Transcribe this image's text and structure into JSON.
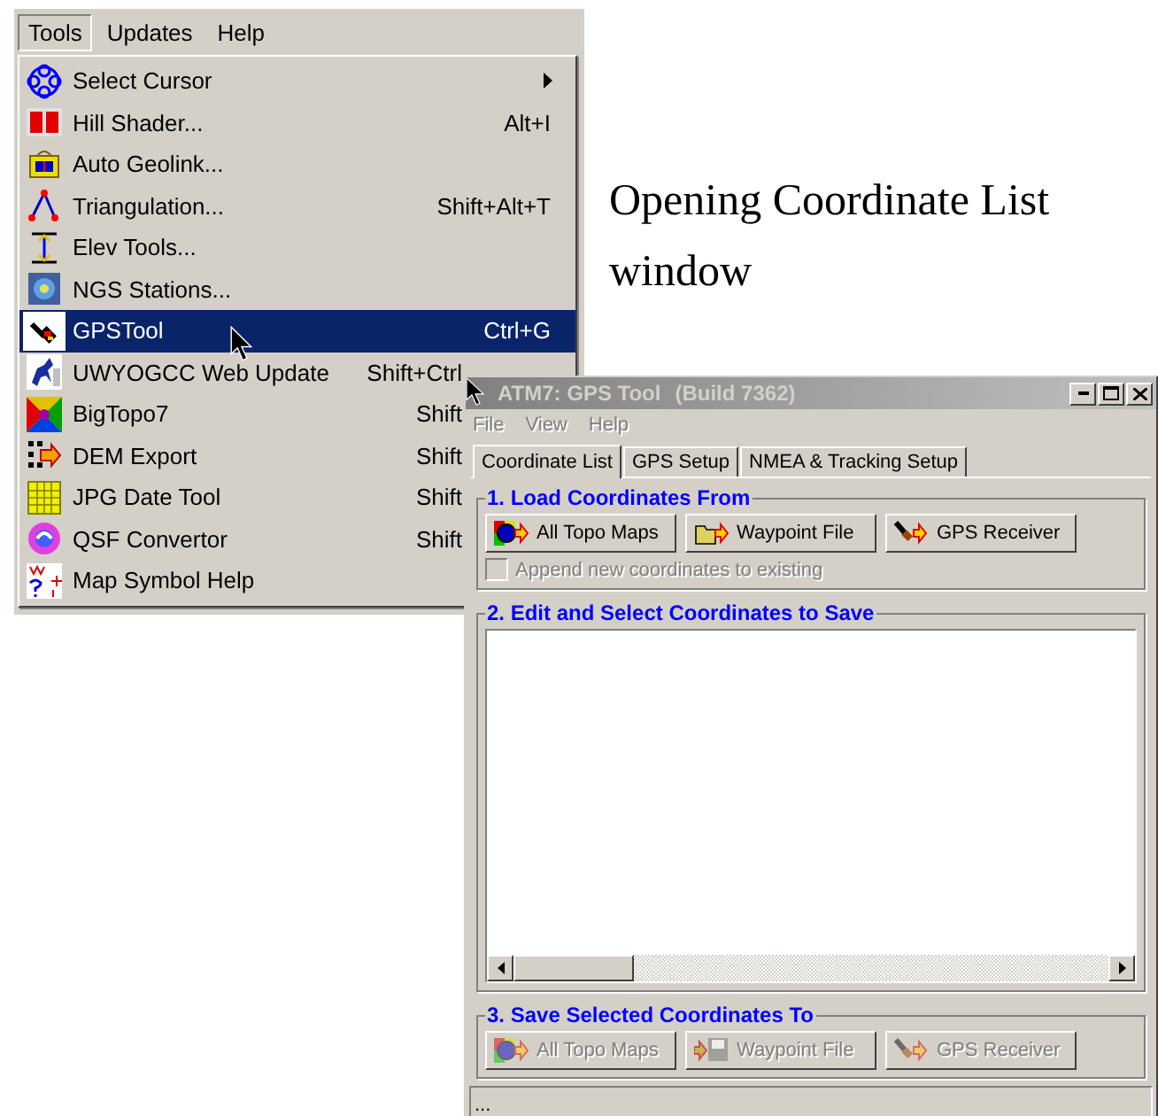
{
  "app_menubar": {
    "items": [
      {
        "label": "Tools",
        "selected": true
      },
      {
        "label": "Updates",
        "selected": false
      },
      {
        "label": "Help",
        "selected": false
      }
    ]
  },
  "tools_menu": {
    "items": [
      {
        "label": "Select Cursor",
        "submenu": true,
        "selected": false
      },
      {
        "label": "Hill Shader...",
        "shortcut": "Alt+I",
        "submenu": false,
        "selected": false
      },
      {
        "label": "Auto Geolink...",
        "submenu": false,
        "selected": false
      },
      {
        "label": "Triangulation...",
        "shortcut": "Shift+Alt+T",
        "submenu": false,
        "selected": false
      },
      {
        "label": "Elev Tools...",
        "submenu": false,
        "selected": false
      },
      {
        "label": "NGS Stations...",
        "submenu": false,
        "selected": false
      },
      {
        "label": "GPSTool",
        "shortcut": "Ctrl+G",
        "submenu": false,
        "selected": true
      },
      {
        "label": "UWYOGCC Web Update",
        "shortcut": "Shift+Ctrl",
        "submenu": false,
        "selected": false
      },
      {
        "label": "BigTopo7",
        "shortcut": "Shift",
        "submenu": false,
        "selected": false
      },
      {
        "label": "DEM Export",
        "shortcut": "Shift",
        "submenu": false,
        "selected": false
      },
      {
        "label": "JPG Date Tool",
        "shortcut": "Shift",
        "submenu": false,
        "selected": false
      },
      {
        "label": "QSF Convertor",
        "shortcut": "Shift",
        "submenu": false,
        "selected": false
      },
      {
        "label": "Map Symbol Help",
        "submenu": false,
        "selected": false
      }
    ]
  },
  "caption": "Opening Coordinate List window",
  "window": {
    "title": "ATM7: GPS Tool",
    "build": "(Build 7362)",
    "menu": [
      {
        "label": "File",
        "disabled": true
      },
      {
        "label": "View",
        "disabled": true
      },
      {
        "label": "Help",
        "disabled": true
      }
    ],
    "tabs": [
      {
        "label": "Coordinate List",
        "selected": true
      },
      {
        "label": "GPS Setup",
        "selected": false
      },
      {
        "label": "NMEA & Tracking Setup",
        "selected": false
      }
    ],
    "groups": [
      {
        "kind": "buttons",
        "title": "1. Load Coordinates From",
        "buttons": [
          {
            "label": "All Topo Maps",
            "disabled": false
          },
          {
            "label": "Waypoint File",
            "disabled": false
          },
          {
            "label": "GPS Receiver",
            "disabled": false
          }
        ],
        "checkbox": {
          "label": "Append new coordinates to existing",
          "checked": false,
          "disabled": true
        }
      },
      {
        "kind": "list",
        "title": "2. Edit and Select Coordinates to Save"
      },
      {
        "kind": "buttons",
        "title": "3. Save Selected Coordinates To",
        "buttons": [
          {
            "label": "All Topo Maps",
            "disabled": true
          },
          {
            "label": "Waypoint File",
            "disabled": true
          },
          {
            "label": "GPS Receiver",
            "disabled": true
          }
        ]
      }
    ],
    "status_bar": "..."
  }
}
